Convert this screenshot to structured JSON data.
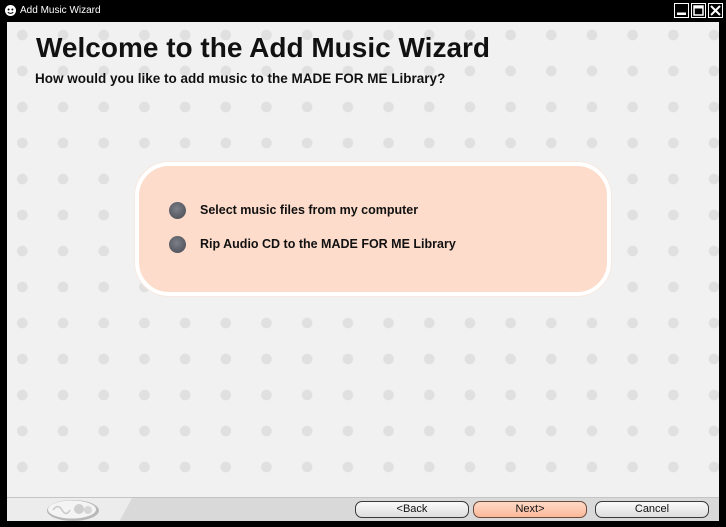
{
  "window": {
    "title": "Add Music Wizard",
    "icon": "wizard-app-icon"
  },
  "page": {
    "heading": "Welcome to the Add Music Wizard",
    "question": "How would you like to add music to the MADE FOR ME Library?"
  },
  "options": [
    {
      "label": "Select music files from my computer",
      "selected": false
    },
    {
      "label": "Rip Audio CD to the MADE FOR ME Library",
      "selected": false
    }
  ],
  "buttons": {
    "back": "<Back",
    "next": "Next>",
    "cancel": "Cancel"
  },
  "colors": {
    "accent_panel": "#fddccb",
    "next_button": "#fbb99a",
    "radio": "#5b5e66"
  }
}
